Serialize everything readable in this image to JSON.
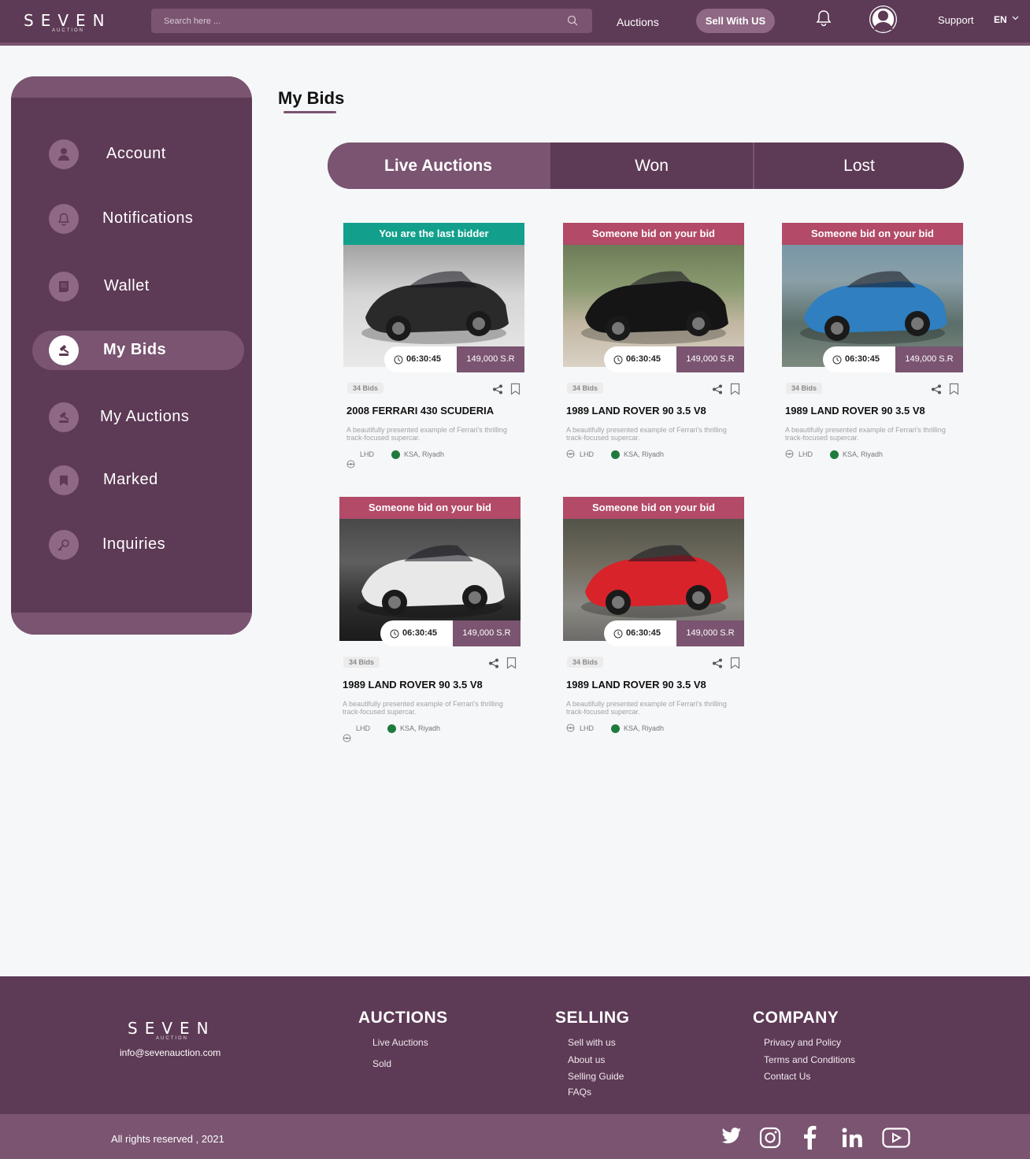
{
  "header": {
    "logo": "SEVEN",
    "logo_sub": "AUCTION",
    "search_placeholder": "Search here ...",
    "nav_auctions": "Auctions",
    "sell_button": "Sell With US",
    "support": "Support",
    "language": "EN"
  },
  "sidebar": {
    "items": [
      {
        "label": "Account",
        "icon": "user-icon"
      },
      {
        "label": "Notifications",
        "icon": "bell-icon"
      },
      {
        "label": "Wallet",
        "icon": "wallet-icon"
      },
      {
        "label": "My Bids",
        "icon": "gavel-icon",
        "active": true
      },
      {
        "label": "My Auctions",
        "icon": "gavel-icon"
      },
      {
        "label": "Marked",
        "icon": "bookmark-icon"
      },
      {
        "label": "Inquiries",
        "icon": "key-icon"
      }
    ]
  },
  "main": {
    "title": "My Bids",
    "tabs": [
      "Live Auctions",
      "Won",
      "Lost"
    ],
    "active_tab": "Live Auctions"
  },
  "cards": [
    {
      "status": "You are the last bidder",
      "status_color": "#12a08c",
      "timer": "06:30:45",
      "price": "149,000 S.R",
      "bids": "34 Bids",
      "name": "2008 FERRARI 430 SCUDERIA",
      "desc": "A beautifully presented example of Ferrari's thrilling track-focused supercar.",
      "drive": "LHD",
      "location": "KSA, Riyadh"
    },
    {
      "status": "Someone bid on your bid",
      "status_color": "#b24a68",
      "timer": "06:30:45",
      "price": "149,000 S.R",
      "bids": "34 Bids",
      "name": "1989 LAND ROVER 90 3.5 V8",
      "desc": "A beautifully presented example of Ferrari's thrilling track-focused supercar.",
      "drive": "LHD",
      "location": "KSA, Riyadh"
    },
    {
      "status": "Someone bid on your bid",
      "status_color": "#b24a68",
      "timer": "06:30:45",
      "price": "149,000 S.R",
      "bids": "34 Bids",
      "name": "1989 LAND ROVER 90 3.5 V8",
      "desc": "A beautifully presented example of Ferrari's thrilling track-focused supercar.",
      "drive": "LHD",
      "location": "KSA, Riyadh"
    },
    {
      "status": "Someone bid on your bid",
      "status_color": "#b24a68",
      "timer": "06:30:45",
      "price": "149,000 S.R",
      "bids": "34 Bids",
      "name": "1989 LAND ROVER 90 3.5 V8",
      "desc": "A beautifully presented example of Ferrari's thrilling track-focused supercar.",
      "drive": "LHD",
      "location": "KSA, Riyadh"
    },
    {
      "status": "Someone bid on your bid",
      "status_color": "#b24a68",
      "timer": "06:30:45",
      "price": "149,000 S.R",
      "bids": "34 Bids",
      "name": "1989 LAND ROVER 90 3.5 V8",
      "desc": "A beautifully presented example of Ferrari's thrilling track-focused supercar.",
      "drive": "LHD",
      "location": "KSA, Riyadh"
    }
  ],
  "footer": {
    "logo": "SEVEN",
    "logo_sub": "AUCTION",
    "email": "info@sevenauction.com",
    "auctions": {
      "heading": "AUCTIONS",
      "links": [
        "Live Auctions",
        "Sold"
      ]
    },
    "selling": {
      "heading": "SELLING",
      "links": [
        "Sell with us",
        "About us",
        "Selling Guide",
        "FAQs"
      ]
    },
    "company": {
      "heading": "COMPANY",
      "links": [
        "Privacy and Policy",
        "Terms and Conditions",
        "Contact Us"
      ]
    },
    "rights": "All  rights reserved , 2021",
    "social": [
      "twitter-icon",
      "instagram-icon",
      "facebook-icon",
      "linkedin-icon",
      "youtube-icon"
    ]
  },
  "colors": {
    "brand": "#5d3a55",
    "brand_light": "#7a5471",
    "accent_green": "#12a08c",
    "accent_red": "#b24a68"
  }
}
